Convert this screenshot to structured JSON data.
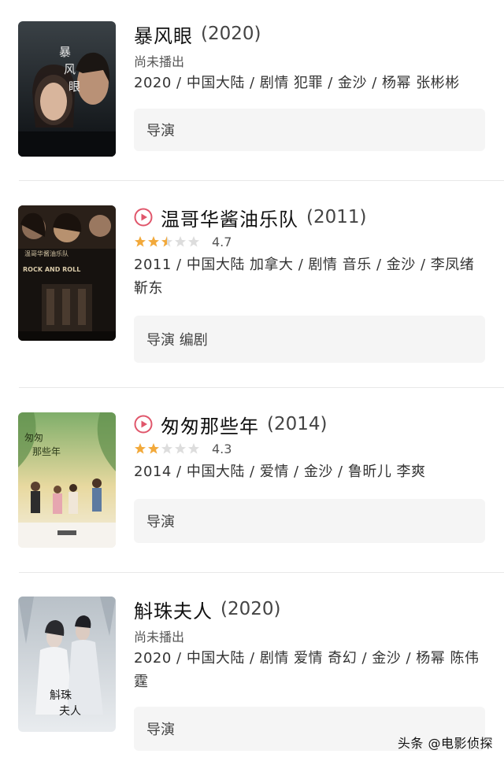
{
  "movies": [
    {
      "title": "暴风眼",
      "year": "(2020)",
      "status": "尚未播出",
      "meta": "2020 / 中国大陆 / 剧情 犯罪 / 金沙 / 杨幂 张彬彬",
      "credits": "导演",
      "poster_text": "暴风眼"
    },
    {
      "title": "温哥华酱油乐队",
      "year": "(2011)",
      "rating": 4.7,
      "stars_filled": 2.5,
      "score": "4.7",
      "meta": "2011 / 中国大陆 加拿大 / 剧情 音乐 / 金沙 / 李凤绪 靳东",
      "credits": "导演 编剧",
      "poster_text": "ROCK AND ROLL"
    },
    {
      "title": "匆匆那些年",
      "year": "(2014)",
      "rating": 4.3,
      "stars_filled": 2,
      "score": "4.3",
      "meta": "2014 / 中国大陆 / 爱情 / 金沙 / 鲁昕儿 李爽",
      "credits": "导演",
      "poster_text": "匆匆那些年"
    },
    {
      "title": "斛珠夫人",
      "year": "(2020)",
      "status": "尚未播出",
      "meta": "2020 / 中国大陆 / 剧情 爱情 奇幻 / 金沙 / 杨幂 陈伟霆",
      "credits": "导演",
      "poster_text": "斛珠夫人"
    }
  ],
  "watermark": "头条 @电影侦探",
  "colors": {
    "star": "#f2a93b",
    "star_empty": "#dddddd",
    "play": "#e0566b",
    "credits_bg": "#f5f5f5"
  }
}
